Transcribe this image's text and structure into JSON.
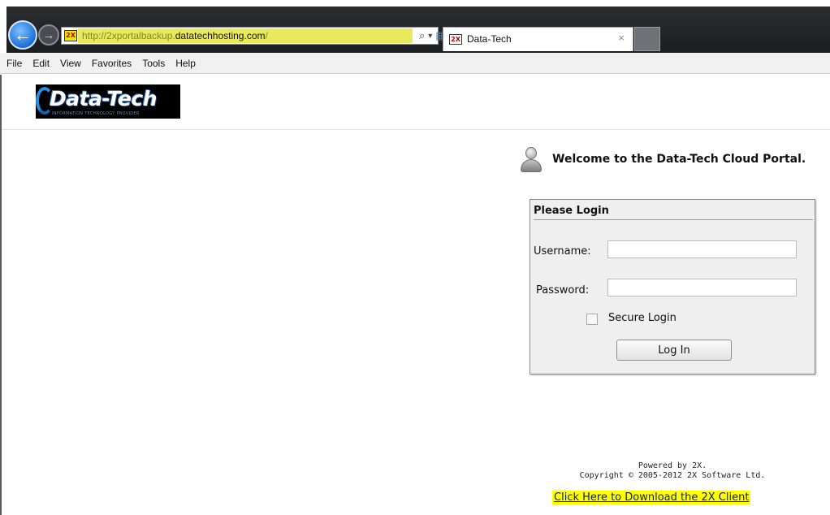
{
  "browser": {
    "address": {
      "url_prefix": "http://2xportalbackup.",
      "url_domain": "datatechhosting.com",
      "url_suffix": "/",
      "favicon_text": "2X"
    },
    "address_icons": {
      "search_glyph": "⌕",
      "dropdown_glyph": "▾",
      "compat_glyph": "▦",
      "refresh_glyph": "↻",
      "stop_glyph": "✕"
    },
    "tab": {
      "favicon_text": "2X",
      "title": "Data-Tech",
      "close_glyph": "×"
    },
    "back_glyph": "←",
    "forward_glyph": "→"
  },
  "menubar": {
    "items": [
      {
        "label": "File"
      },
      {
        "label": "Edit"
      },
      {
        "label": "View"
      },
      {
        "label": "Favorites"
      },
      {
        "label": "Tools"
      },
      {
        "label": "Help"
      }
    ]
  },
  "header": {
    "logo_text": "Data-Tech",
    "logo_tagline": "INFORMATION TECHNOLOGY PROVIDER"
  },
  "welcome": {
    "text": "Welcome to the Data-Tech Cloud Portal."
  },
  "login": {
    "title": "Please Login",
    "username_label": "Username:",
    "username_value": "",
    "password_label": "Password:",
    "password_value": "",
    "secure_label": "Secure Login",
    "secure_checked": false,
    "submit_label": "Log In"
  },
  "footer": {
    "powered_by": "Powered by 2X.",
    "copyright": "Copyright © 2005-2012 2X Software Ltd.",
    "download_link": "Click Here to Download the 2X Client"
  },
  "colors": {
    "link_highlight": "#ffff00",
    "address_highlight": "#e8ea5c",
    "back_button": "#1b6fd8"
  }
}
